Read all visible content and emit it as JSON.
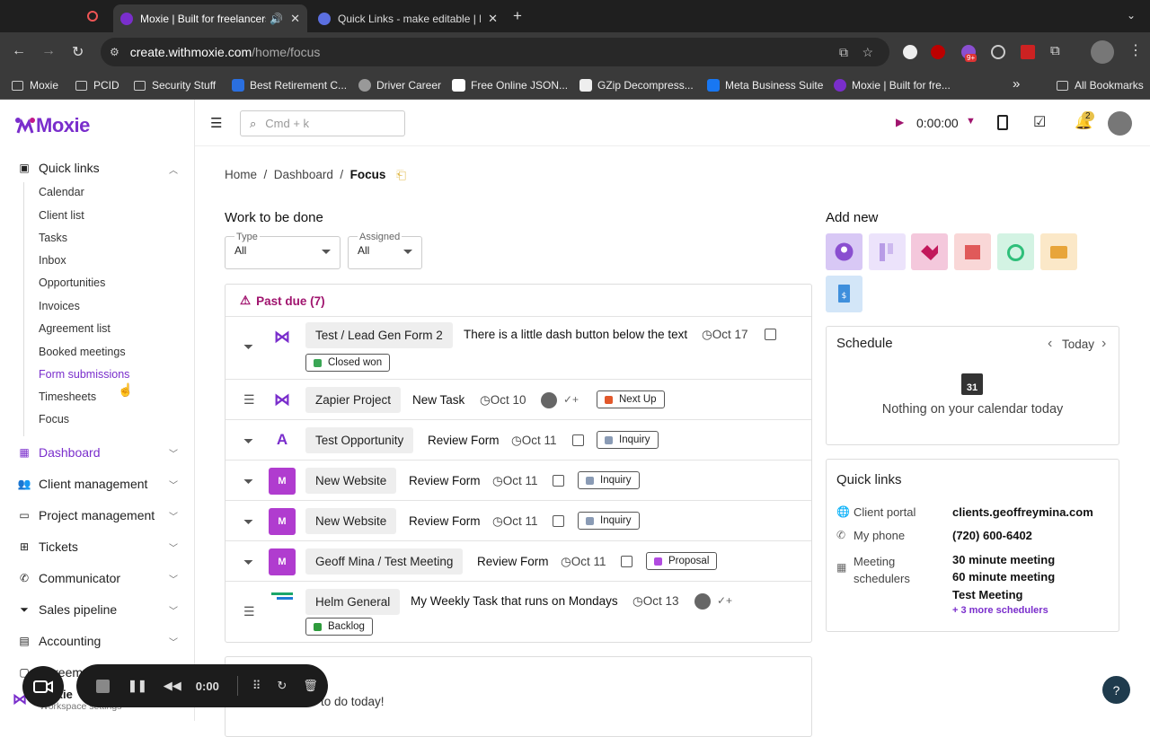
{
  "browser": {
    "tabs": [
      {
        "title": "Moxie | Built for freelancers"
      },
      {
        "title": "Quick Links - make editable | Moxie"
      }
    ],
    "url_host": "create.withmoxie.com",
    "url_path": "/home/focus",
    "badge": "9+",
    "bookmarks": [
      "Moxie",
      "PCID",
      "Security Stuff",
      "Best Retirement C...",
      "Driver Career",
      "Free Online JSON...",
      "GZip Decompress...",
      "Meta Business Suite",
      "Moxie | Built for fre..."
    ],
    "all_bookmarks": "All Bookmarks",
    "more": "»"
  },
  "sidebar": {
    "logo": "Moxie",
    "quick_links_label": "Quick links",
    "quick_links": [
      "Calendar",
      "Client list",
      "Tasks",
      "Inbox",
      "Opportunities",
      "Invoices",
      "Agreement list",
      "Booked meetings",
      "Form submissions",
      "Timesheets",
      "Focus"
    ],
    "nav": [
      "Dashboard",
      "Client management",
      "Project management",
      "Tickets",
      "Communicator",
      "Sales pipeline",
      "Accounting"
    ],
    "partial_bottom": "Agreem",
    "workspace_name": "Moxie",
    "workspace_settings": "Workspace settings"
  },
  "recorder": {
    "time": "0:00"
  },
  "topbar": {
    "search_placeholder": "Cmd + k",
    "timer": "0:00:00",
    "notifications": "2"
  },
  "breadcrumb": {
    "home": "Home",
    "dashboard": "Dashboard",
    "current": "Focus"
  },
  "work": {
    "title": "Work to be done",
    "type_label": "Type",
    "type_value": "All",
    "assigned_label": "Assigned",
    "assigned_value": "All",
    "past_due": "Past due (7)",
    "rows": [
      {
        "project": "Test / Lead Gen Form 2",
        "task": "There is a little dash button below the text",
        "date": "Oct 17",
        "status": "Closed won",
        "status_color": "#3aa655"
      },
      {
        "project": "Zapier Project",
        "task": "New Task",
        "date": "Oct 10",
        "status": "Next Up",
        "status_color": "#e2582b"
      },
      {
        "project": "Test Opportunity",
        "task": "Review Form",
        "date": "Oct 11",
        "status": "Inquiry",
        "status_color": "#8a9bb5"
      },
      {
        "avatar": "M",
        "project": "New Website",
        "task": "Review Form",
        "date": "Oct 11",
        "status": "Inquiry",
        "status_color": "#8a9bb5"
      },
      {
        "avatar": "M",
        "project": "New Website",
        "task": "Review Form",
        "date": "Oct 11",
        "status": "Inquiry",
        "status_color": "#8a9bb5"
      },
      {
        "avatar": "M",
        "project": "Geoff Mina / Test Meeting",
        "task": "Review Form",
        "date": "Oct 11",
        "status": "Proposal",
        "status_color": "#b14be0"
      },
      {
        "project": "Helm General",
        "task": "My Weekly Task that runs on Mondays",
        "date": "Oct 13",
        "status": "Backlog",
        "status_color": "#2e9b3c"
      }
    ],
    "today_text": "to do today!"
  },
  "add_new": {
    "title": "Add new"
  },
  "schedule": {
    "title": "Schedule",
    "nav_label": "Today",
    "cal_day": "31",
    "empty": "Nothing on your calendar today"
  },
  "quick_links_panel": {
    "title": "Quick links",
    "client_portal_label": "Client portal",
    "client_portal_value": "clients.geoffreymina.com",
    "phone_label": "My phone",
    "phone_value": "(720) 600-6402",
    "meeting_label": "Meeting schedulers",
    "meetings": [
      "30 minute meeting",
      "60 minute meeting",
      "Test Meeting"
    ],
    "more": "+ 3 more schedulers"
  }
}
